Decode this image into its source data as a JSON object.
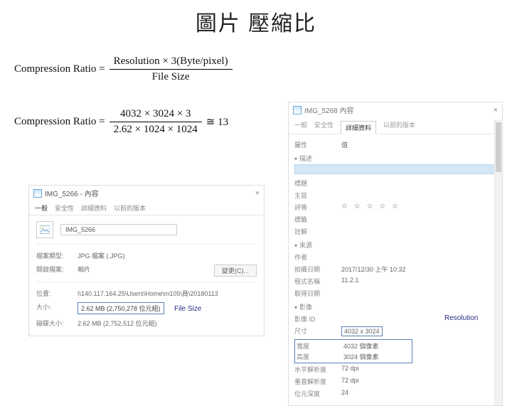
{
  "title": "圖片 壓縮比",
  "formula1": {
    "label": "Compression Ratio =",
    "num": "Resolution × 3(Byte/pixel)",
    "den": "File Size"
  },
  "formula2": {
    "label": "Compression Ratio =",
    "num": "4032 × 3024 × 3",
    "den": "2.62 × 1024 × 1024",
    "approx": "≅ 13"
  },
  "left": {
    "title": "IMG_5266 - 內容",
    "tabs": {
      "t1": "一般",
      "t2": "安全性",
      "t3": "詳細資料",
      "t4": "以前的版本"
    },
    "filename": "IMG_5266",
    "rows": {
      "type_l": "檔案類型:",
      "type_v": "JPG 檔案 (.JPG)",
      "open_l": "開啟檔案:",
      "open_v": "相片",
      "open_btn": "變更(C)...",
      "loc_l": "位置:",
      "loc_v": "\\\\140.117.164.25\\Users\\Home\\m105\\員\\20180113",
      "size_l": "大小:",
      "size_v": "2.62 MB (2,750,278 位元組)",
      "disk_l": "磁碟大小:",
      "disk_v": "2.62 MB (2,752,512 位元組)"
    }
  },
  "callouts": {
    "filesize": "File Size",
    "resolution": "Resolution"
  },
  "right": {
    "title": "IMG_5268  內容",
    "tabs": {
      "t1": "一般",
      "t2": "安全性",
      "t3": "詳細資料",
      "t4": "以前的版本"
    },
    "sec_desc": "描述",
    "rows_top": {
      "attr_l": "屬性",
      "attr_v": "值",
      "title_l": "標題",
      "subject_l": "主旨",
      "rating_l": "評等",
      "rating_v": "☆ ☆ ☆ ☆ ☆",
      "tags_l": "標籤",
      "comment_l": "註解"
    },
    "sec_origin": "來源",
    "rows_origin": {
      "author_l": "作者",
      "date_l": "拍攝日期",
      "date_v": "2017/12/30 上午 10:32",
      "program_l": "程式名稱",
      "program_v": "11.2.1",
      "acquired_l": "取得日期"
    },
    "sec_image": "影像",
    "rows_image": {
      "imgid_l": "影像 ID",
      "dim_l": "尺寸",
      "dim_v": "4032 x 3024",
      "width_l": "寬度",
      "width_v": "4032 個像素",
      "height_l": "高度",
      "height_v": "3024 個像素",
      "hres_l": "水平解析度",
      "hres_v": "72 dpi",
      "vres_l": "垂直解析度",
      "vres_v": "72 dpi",
      "depth_l": "位元深度",
      "depth_v": "24"
    }
  }
}
